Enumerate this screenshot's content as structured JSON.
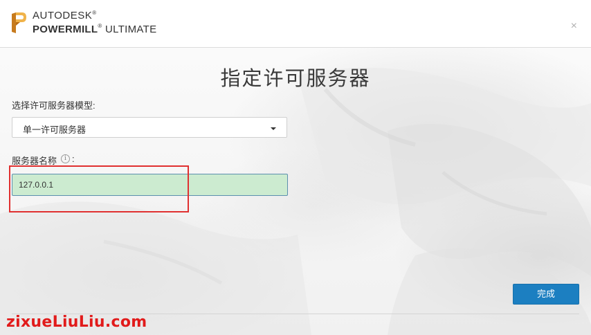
{
  "header": {
    "brand_company": "AUTODESK",
    "brand_product_bold": "POWERMILL",
    "brand_product_edition": "ULTIMATE",
    "logo_letter": "P",
    "close_icon": "×"
  },
  "main": {
    "title": "指定许可服务器",
    "model_label": "选择许可服务器模型:",
    "model_select": {
      "selected": "单一许可服务器"
    },
    "server_name_label": "服务器名称",
    "server_name_suffix": ":",
    "server_name_value": "127.0.0.1",
    "info_icon_glyph": "i",
    "finish_button": "完成"
  },
  "watermark": "zixueLiuLiu.com",
  "colors": {
    "accent_button": "#1c7fc1",
    "input_fill": "#ccebd0",
    "highlight_box": "#e03030",
    "watermark": "#e11b1b",
    "logo_orange": "#e8a33c"
  }
}
